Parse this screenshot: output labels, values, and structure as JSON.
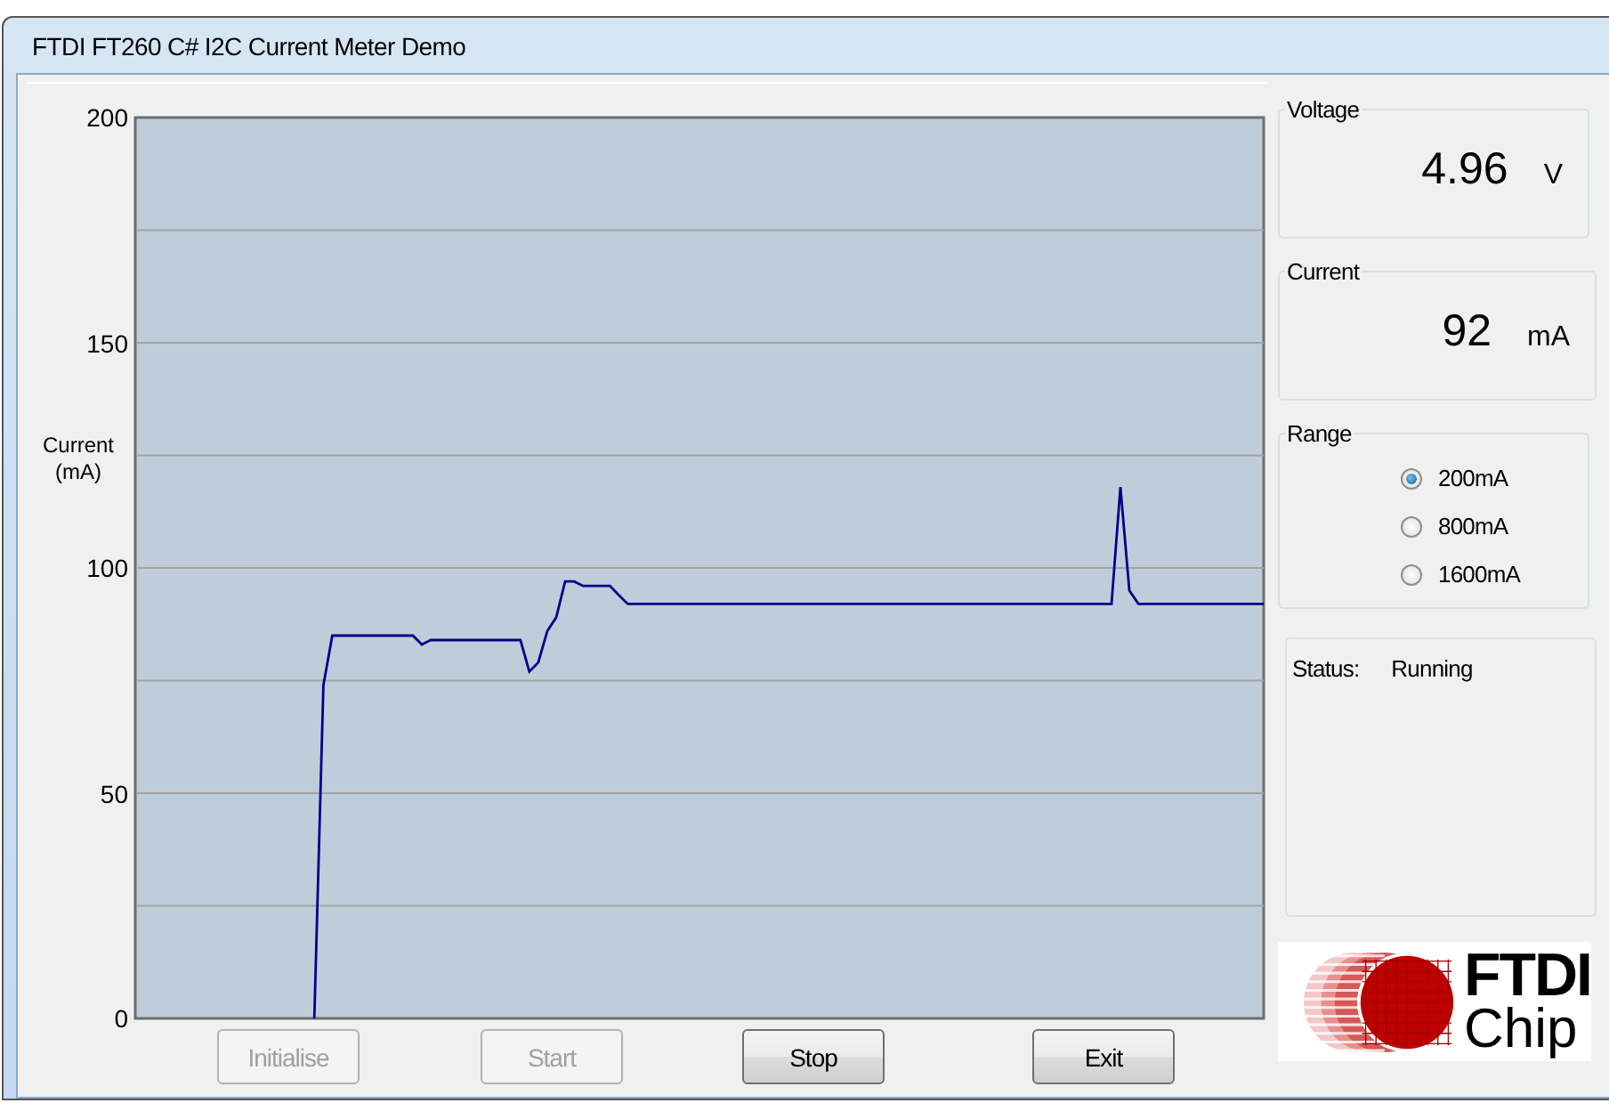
{
  "window": {
    "title": "FTDI FT260 C# I2C Current Meter Demo"
  },
  "chart": {
    "chart_data": {
      "type": "line",
      "grid": true,
      "ylabel": "Current (mA)",
      "ylim": [
        0,
        200
      ],
      "yticks": [
        0,
        50,
        100,
        150,
        200
      ],
      "categories": [
        null,
        null,
        null,
        null,
        null,
        null,
        null,
        null,
        null,
        null,
        null,
        null,
        null,
        null,
        null,
        null,
        null,
        null,
        null,
        null,
        null,
        null,
        null,
        null,
        null,
        null,
        null,
        null,
        null,
        null,
        null,
        null,
        null,
        null,
        null,
        null,
        null,
        null,
        null,
        null,
        null,
        null,
        null,
        null,
        null,
        null,
        null,
        null,
        null,
        null,
        null,
        null,
        null,
        null,
        null,
        null,
        null,
        null,
        null,
        null,
        null,
        null,
        null,
        null,
        null,
        null,
        null,
        null,
        null,
        null,
        null,
        null,
        null,
        null,
        null,
        null,
        null,
        null,
        null,
        null,
        null,
        null,
        null,
        null,
        null,
        null,
        null,
        null,
        null,
        null,
        null,
        null,
        null,
        null,
        null,
        null,
        null,
        null,
        null,
        null,
        null,
        null,
        null,
        null,
        null,
        null,
        null,
        null,
        null,
        null,
        null,
        null,
        null,
        null,
        null,
        null,
        null,
        null,
        null,
        null,
        null,
        null,
        null,
        null,
        null,
        null,
        null
      ],
      "series": [
        {
          "color": "#00008b",
          "values": [
            null,
            null,
            null,
            null,
            null,
            null,
            null,
            null,
            null,
            null,
            null,
            null,
            null,
            null,
            null,
            null,
            null,
            null,
            null,
            null,
            0,
            74,
            85,
            85,
            85,
            85,
            85,
            85,
            85,
            85,
            85,
            85,
            83,
            84,
            84,
            84,
            84,
            84,
            84,
            84,
            84,
            84,
            84,
            84,
            77,
            79,
            86,
            89,
            97,
            97,
            96,
            96,
            96,
            96,
            94,
            92,
            92,
            92,
            92,
            92,
            92,
            92,
            92,
            92,
            92,
            92,
            92,
            92,
            92,
            92,
            92,
            92,
            92,
            92,
            92,
            92,
            92,
            92,
            92,
            92,
            92,
            92,
            92,
            92,
            92,
            92,
            92,
            92,
            92,
            92,
            92,
            92,
            92,
            92,
            92,
            92,
            92,
            92,
            92,
            92,
            92,
            92,
            92,
            92,
            92,
            92,
            92,
            92,
            92,
            92,
            118,
            95,
            92,
            92,
            92,
            92,
            92,
            92,
            92,
            92,
            92,
            92,
            92,
            92,
            92,
            92,
            92
          ]
        }
      ]
    }
  },
  "buttons": [
    {
      "label": "Initialise",
      "disabled": true
    },
    {
      "label": "Start",
      "disabled": true
    },
    {
      "label": "Stop",
      "disabled": false
    },
    {
      "label": "Exit",
      "disabled": false
    }
  ],
  "voltage": {
    "title": "Voltage",
    "value": "4.96",
    "unit": "V"
  },
  "current": {
    "title": "Current",
    "value": "92",
    "unit": "mA"
  },
  "range": {
    "title": "Range",
    "options": [
      {
        "label": "200mA",
        "selected": true
      },
      {
        "label": "800mA",
        "selected": false
      },
      {
        "label": "1600mA",
        "selected": false
      }
    ]
  },
  "status": {
    "label": "Status:",
    "value": "Running"
  },
  "logo": {
    "line_1": "FTDI",
    "line_2": "Chip"
  }
}
